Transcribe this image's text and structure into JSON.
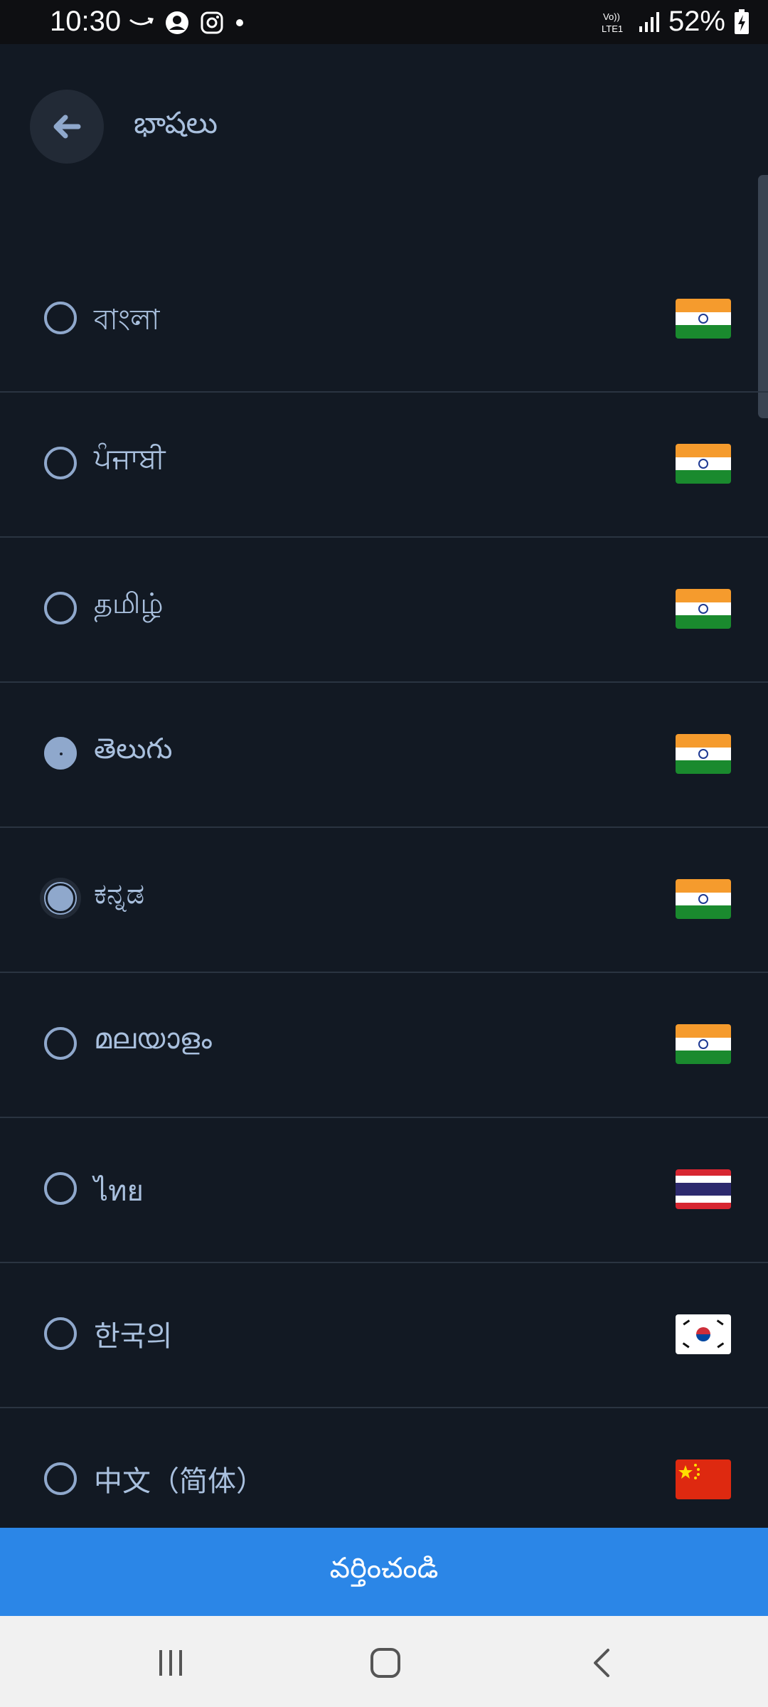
{
  "status_bar": {
    "time": "10:30",
    "network_label": "Vo)) LTE1",
    "battery_percent": "52%"
  },
  "header": {
    "title": "భాషలు"
  },
  "languages": [
    {
      "label": "বাংলা",
      "flag": "india",
      "state": "unselected"
    },
    {
      "label": "ਪੰਜਾਬੀ",
      "flag": "india",
      "state": "unselected"
    },
    {
      "label": "தமிழ்",
      "flag": "india",
      "state": "unselected"
    },
    {
      "label": "తెలుగు",
      "flag": "india",
      "state": "selected"
    },
    {
      "label": "ಕನ್ನಡ",
      "flag": "india",
      "state": "pressed"
    },
    {
      "label": "മലയാളം",
      "flag": "india",
      "state": "unselected"
    },
    {
      "label": "ไทย",
      "flag": "thailand",
      "state": "unselected"
    },
    {
      "label": "한국의",
      "flag": "south-korea",
      "state": "unselected"
    },
    {
      "label": "中文（简体）",
      "flag": "china",
      "state": "unselected"
    }
  ],
  "apply_button": {
    "label": "వర్తించండి"
  },
  "colors": {
    "background": "#121923",
    "accent": "#2b86e7",
    "text": "#a9c0de",
    "radio": "#8fa8cc"
  }
}
